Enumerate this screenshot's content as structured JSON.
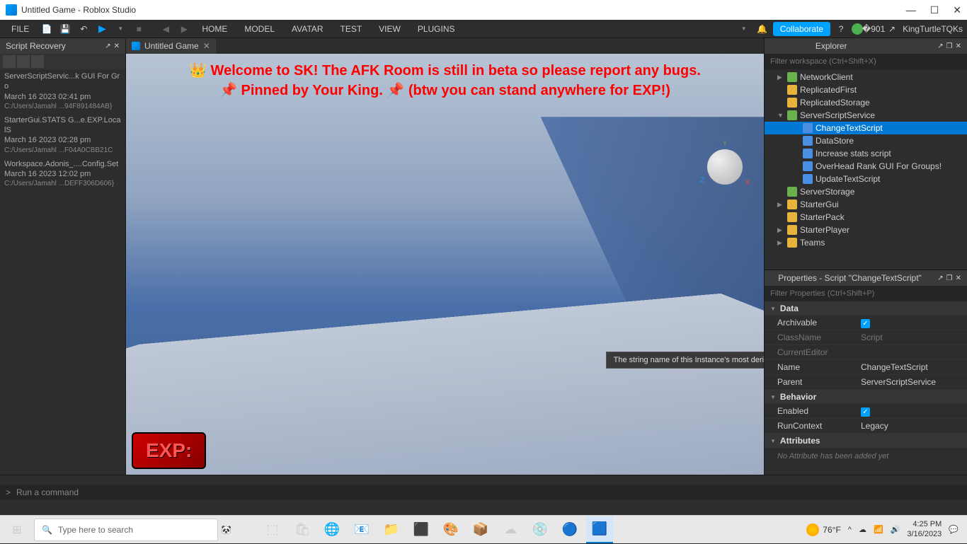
{
  "window": {
    "title": "Untitled Game - Roblox Studio"
  },
  "menubar": {
    "file": "FILE",
    "items": [
      "HOME",
      "MODEL",
      "AVATAR",
      "TEST",
      "VIEW",
      "PLUGINS"
    ],
    "collaborate": "Collaborate",
    "username": "KingTurtleTQKs"
  },
  "left_panel": {
    "title": "Script Recovery",
    "items": [
      {
        "name": "ServerScriptServic...k GUI For Gro",
        "date": "March 16 2023 02:41 pm",
        "path": "C:/Users/Jamahl ...94F891484AB}"
      },
      {
        "name": "StarterGui.STATS G...e.EXP.LocalS",
        "date": "March 16 2023 02:28 pm",
        "path": "C:/Users/Jamahl ...F04A0CBB21C"
      },
      {
        "name": "Workspace.Adonis_....Config.Set",
        "date": "March 16 2023 12:02 pm",
        "path": "C:/Users/Jamahl ...DEFF306D606}"
      }
    ]
  },
  "tab": {
    "name": "Untitled Game"
  },
  "viewport": {
    "banner_line1": "👑 Welcome to SK! The AFK Room is still in beta so please report any bugs.",
    "banner_line2": "📌 Pinned by Your King. 📌 (btw you can stand anywhere for EXP!)",
    "exp_label": "EXP:",
    "tooltip": "The string name of this Instance's most derived class.",
    "axes": {
      "x": "X",
      "y": "Y",
      "z": "Z"
    }
  },
  "explorer": {
    "title": "Explorer",
    "filter_placeholder": "Filter workspace (Ctrl+Shift+X)",
    "tree": [
      {
        "label": "NetworkClient",
        "indent": 1,
        "icon": "service",
        "arrow": "▶"
      },
      {
        "label": "ReplicatedFirst",
        "indent": 1,
        "icon": "folder",
        "arrow": ""
      },
      {
        "label": "ReplicatedStorage",
        "indent": 1,
        "icon": "folder",
        "arrow": ""
      },
      {
        "label": "ServerScriptService",
        "indent": 1,
        "icon": "service",
        "arrow": "▼"
      },
      {
        "label": "ChangeTextScript",
        "indent": 2,
        "icon": "script",
        "selected": true
      },
      {
        "label": "DataStore",
        "indent": 2,
        "icon": "script"
      },
      {
        "label": "Increase stats  script",
        "indent": 2,
        "icon": "script"
      },
      {
        "label": "OverHead Rank GUI For Groups!",
        "indent": 2,
        "icon": "script"
      },
      {
        "label": "UpdateTextScript",
        "indent": 2,
        "icon": "script"
      },
      {
        "label": "ServerStorage",
        "indent": 1,
        "icon": "service",
        "arrow": ""
      },
      {
        "label": "StarterGui",
        "indent": 1,
        "icon": "folder",
        "arrow": "▶"
      },
      {
        "label": "StarterPack",
        "indent": 1,
        "icon": "folder",
        "arrow": ""
      },
      {
        "label": "StarterPlayer",
        "indent": 1,
        "icon": "folder",
        "arrow": "▶"
      },
      {
        "label": "Teams",
        "indent": 1,
        "icon": "folder",
        "arrow": "▶"
      }
    ]
  },
  "properties": {
    "title": "Properties - Script \"ChangeTextScript\"",
    "filter_placeholder": "Filter Properties (Ctrl+Shift+P)",
    "sections": {
      "data": "Data",
      "behavior": "Behavior",
      "attributes": "Attributes"
    },
    "rows": {
      "archivable": {
        "key": "Archivable",
        "checked": true
      },
      "classname": {
        "key": "ClassName",
        "val": "Script"
      },
      "currenteditor": {
        "key": "CurrentEditor"
      },
      "name": {
        "key": "Name",
        "val": "ChangeTextScript"
      },
      "parent": {
        "key": "Parent",
        "val": "ServerScriptService"
      },
      "enabled": {
        "key": "Enabled",
        "checked": true
      },
      "runcontext": {
        "key": "RunContext",
        "val": "Legacy"
      }
    },
    "no_attr": "No Attribute has been added yet"
  },
  "command": {
    "prompt": ">",
    "placeholder": "Run a command"
  },
  "taskbar": {
    "search_placeholder": "Type here to search",
    "weather": "76°F",
    "time": "4:25 PM",
    "date": "3/16/2023"
  }
}
